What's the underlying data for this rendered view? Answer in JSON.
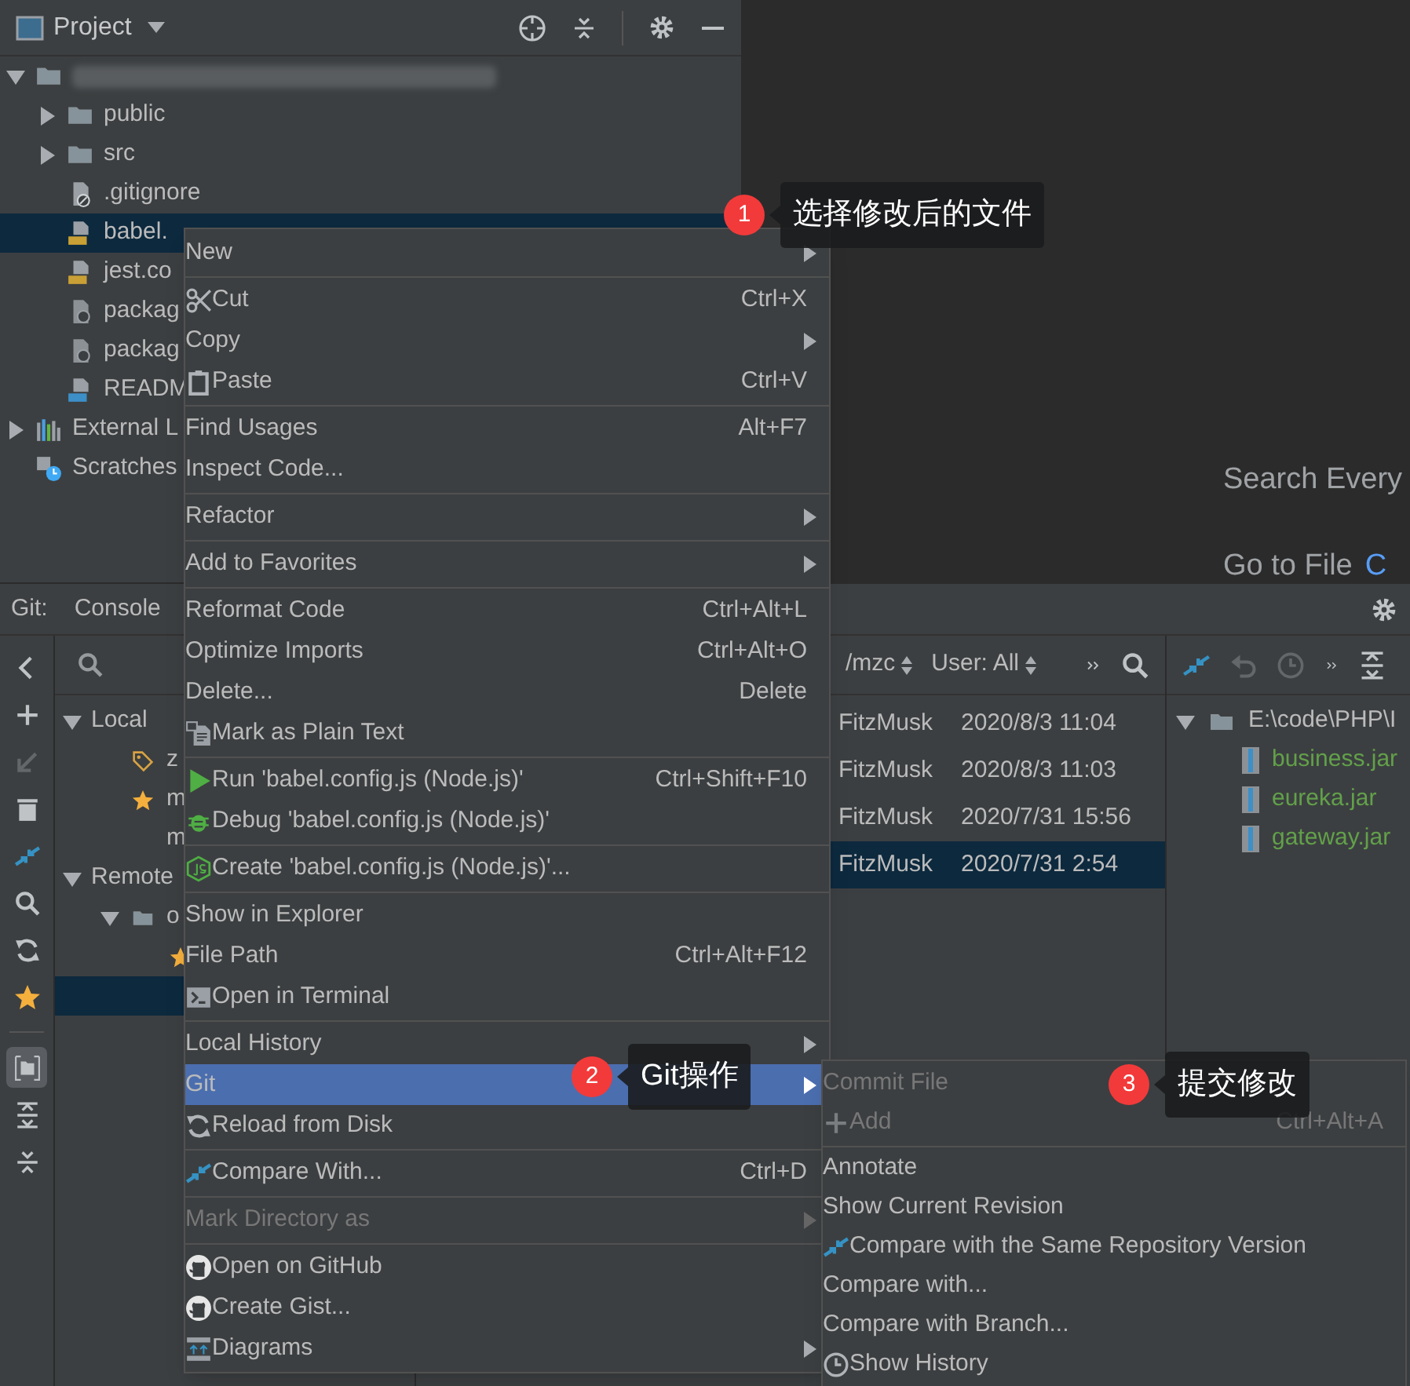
{
  "project_panel": {
    "title": "Project",
    "tree": [
      {
        "kind": "folder",
        "expanded": true,
        "redacted": true,
        "selected": false,
        "children": [
          {
            "label": "public",
            "kind": "folder",
            "expanded": false,
            "selected": false
          },
          {
            "label": "src",
            "kind": "folder",
            "expanded": false,
            "selected": false
          },
          {
            "label": ".gitignore",
            "kind": "ignore",
            "selected": false
          },
          {
            "label": "babel.",
            "kind": "js",
            "selected": true
          },
          {
            "label": "jest.co",
            "kind": "js",
            "selected": false
          },
          {
            "label": "packag",
            "kind": "json",
            "selected": false
          },
          {
            "label": "packag",
            "kind": "json",
            "selected": false
          },
          {
            "label": "READM",
            "kind": "md",
            "selected": false
          }
        ]
      },
      {
        "label": "External L",
        "kind": "library",
        "expanded": false,
        "selected": false
      },
      {
        "label": "Scratches",
        "kind": "scratches",
        "selected": false
      }
    ]
  },
  "editor_hints": [
    {
      "text": "Search Every"
    },
    {
      "text": "Go to File",
      "shortcut": "C"
    }
  ],
  "git_panel": {
    "label": "Git:",
    "tab": "Console",
    "toolbar": [
      {
        "kind": "back",
        "disabled": false,
        "selected": false
      },
      {
        "kind": "add",
        "disabled": false,
        "selected": false
      },
      {
        "kind": "checkout",
        "disabled": true,
        "selected": false
      },
      {
        "kind": "delete",
        "disabled": false,
        "selected": false
      },
      {
        "kind": "compare",
        "disabled": false,
        "selected": false
      },
      {
        "kind": "search",
        "disabled": false,
        "selected": false
      },
      {
        "kind": "refresh",
        "disabled": false,
        "selected": false
      },
      {
        "kind": "favorite",
        "disabled": false,
        "selected": false
      },
      {
        "kind": "branches",
        "disabled": false,
        "selected": true
      },
      {
        "kind": "expand",
        "disabled": false,
        "selected": false
      },
      {
        "kind": "collapse",
        "disabled": false,
        "selected": false
      }
    ],
    "branches": [
      {
        "label": "Local",
        "expanded": true,
        "selected": false,
        "children": [
          {
            "label": "z",
            "kind": "tag",
            "selected": false
          },
          {
            "label": "m",
            "kind": "star",
            "selected": false
          },
          {
            "label": "m",
            "selected": false
          }
        ]
      },
      {
        "label": "Remote",
        "expanded": true,
        "selected": false,
        "children": [
          {
            "label": "o",
            "kind": "folder",
            "expanded": true,
            "selected": false,
            "children": [
              {
                "kind": "star",
                "selected": false
              },
              {
                "selected": true
              }
            ]
          }
        ]
      }
    ],
    "log_filters": [
      {
        "label": "/mzc"
      },
      {
        "label": "User: All"
      }
    ],
    "commits": [
      {
        "author": "FitzMusk",
        "date": "2020/8/3 11:04",
        "selected": false
      },
      {
        "author": "FitzMusk",
        "date": "2020/8/3 11:03",
        "selected": false
      },
      {
        "author": "FitzMusk",
        "date": "2020/7/31 15:56",
        "selected": false
      },
      {
        "author": "FitzMusk",
        "date": "2020/7/31 2:54",
        "selected": true
      }
    ],
    "changes_toolbar": [
      {
        "kind": "compare",
        "disabled": false
      },
      {
        "kind": "undo",
        "disabled": true
      },
      {
        "kind": "history",
        "disabled": true
      },
      {
        "kind": "more",
        "disabled": false
      },
      {
        "kind": "expand",
        "disabled": false
      }
    ],
    "changes": [
      {
        "label": "E:\\code\\PHP\\I",
        "expanded": true,
        "children": [
          {
            "label": "business.jar"
          },
          {
            "label": "eureka.jar"
          },
          {
            "label": "gateway.jar"
          }
        ]
      }
    ]
  },
  "context_menu": [
    [
      {
        "label": "New",
        "submenu": true
      }
    ],
    [
      {
        "label": "Cut",
        "kind": "scissors",
        "shortcut": "Ctrl+X"
      },
      {
        "label": "Copy",
        "submenu": true
      },
      {
        "label": "Paste",
        "kind": "clipboard",
        "shortcut": "Ctrl+V"
      }
    ],
    [
      {
        "label": "Find Usages",
        "shortcut": "Alt+F7"
      },
      {
        "label": "Inspect Code..."
      }
    ],
    [
      {
        "label": "Refactor",
        "submenu": true
      }
    ],
    [
      {
        "label": "Add to Favorites",
        "submenu": true
      }
    ],
    [
      {
        "label": "Reformat Code",
        "shortcut": "Ctrl+Alt+L"
      },
      {
        "label": "Optimize Imports",
        "shortcut": "Ctrl+Alt+O"
      },
      {
        "label": "Delete...",
        "shortcut": "Delete"
      },
      {
        "label": "Mark as Plain Text",
        "kind": "plaintext"
      }
    ],
    [
      {
        "label": "Run 'babel.config.js (Node.js)'",
        "kind": "run",
        "shortcut": "Ctrl+Shift+F10"
      },
      {
        "label": "Debug 'babel.config.js (Node.js)'",
        "kind": "debug"
      }
    ],
    [
      {
        "label": "Create 'babel.config.js (Node.js)'...",
        "kind": "nodejs"
      }
    ],
    [
      {
        "label": "Show in Explorer"
      },
      {
        "label": "File Path",
        "shortcut": "Ctrl+Alt+F12"
      },
      {
        "label": "Open in Terminal",
        "kind": "terminal"
      }
    ],
    [
      {
        "label": "Local History",
        "submenu": true
      },
      {
        "label": "Git",
        "submenu": true,
        "selected": true
      },
      {
        "label": "Reload from Disk",
        "kind": "reload"
      }
    ],
    [
      {
        "label": "Compare With...",
        "kind": "compare",
        "shortcut": "Ctrl+D"
      }
    ],
    [
      {
        "label": "Mark Directory as",
        "submenu": true,
        "disabled": true
      }
    ],
    [
      {
        "label": "Open on GitHub",
        "kind": "github"
      },
      {
        "label": "Create Gist...",
        "kind": "github"
      },
      {
        "label": "Diagrams",
        "kind": "diagram",
        "submenu": true
      }
    ]
  ],
  "git_submenu": [
    [
      {
        "label": "Commit File",
        "disabled": true
      },
      {
        "label": "Add",
        "kind": "plus",
        "shortcut": "Ctrl+Alt+A",
        "disabled": true
      }
    ],
    [
      {
        "label": "Annotate"
      },
      {
        "label": "Show Current Revision"
      },
      {
        "label": "Compare with the Same Repository Version",
        "kind": "compare"
      },
      {
        "label": "Compare with..."
      },
      {
        "label": "Compare with Branch..."
      },
      {
        "label": "Show History",
        "kind": "clock"
      }
    ]
  ],
  "callouts": [
    {
      "number": "1",
      "text": "选择修改后的文件"
    },
    {
      "number": "2",
      "text": "Git操作"
    },
    {
      "number": "3",
      "text": "提交修改"
    }
  ]
}
